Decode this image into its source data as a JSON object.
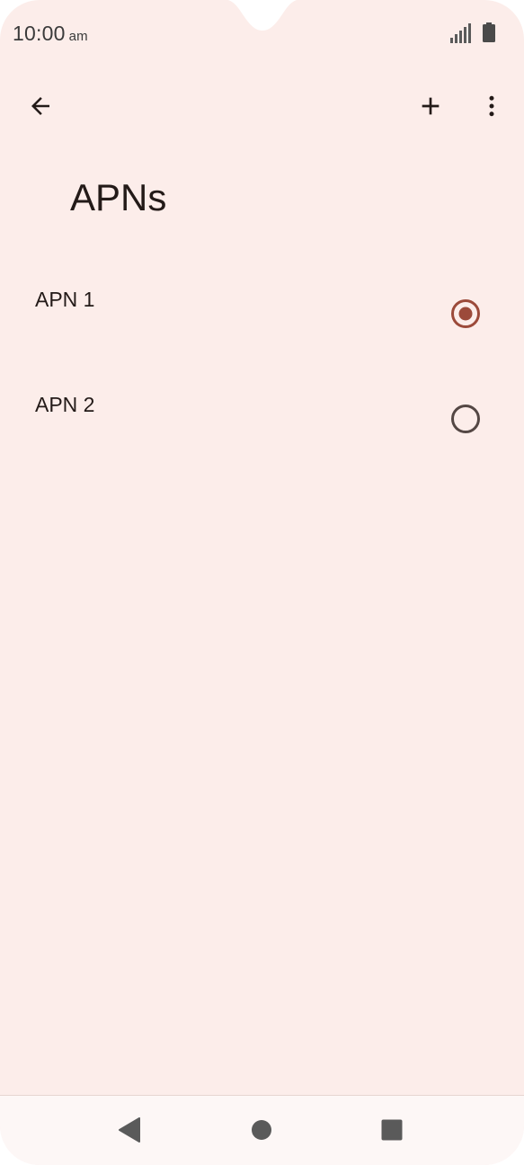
{
  "status_bar": {
    "time": "10:00",
    "ampm": "am",
    "signal_icon": "signal-icon",
    "battery_icon": "battery-icon"
  },
  "toolbar": {
    "back_icon": "arrow-back-icon",
    "add_icon": "plus-icon",
    "more_icon": "more-vertical-icon"
  },
  "page": {
    "title": "APNs"
  },
  "apns": [
    {
      "label": "APN 1",
      "selected": true
    },
    {
      "label": "APN 2",
      "selected": false
    }
  ],
  "nav_bar": {
    "back_icon": "triangle-back-icon",
    "home_icon": "circle-home-icon",
    "recents_icon": "square-recents-icon"
  },
  "colors": {
    "background": "#fcedea",
    "accent": "#9c4a3a",
    "text": "#231a18",
    "radio_unselected": "#544744"
  }
}
